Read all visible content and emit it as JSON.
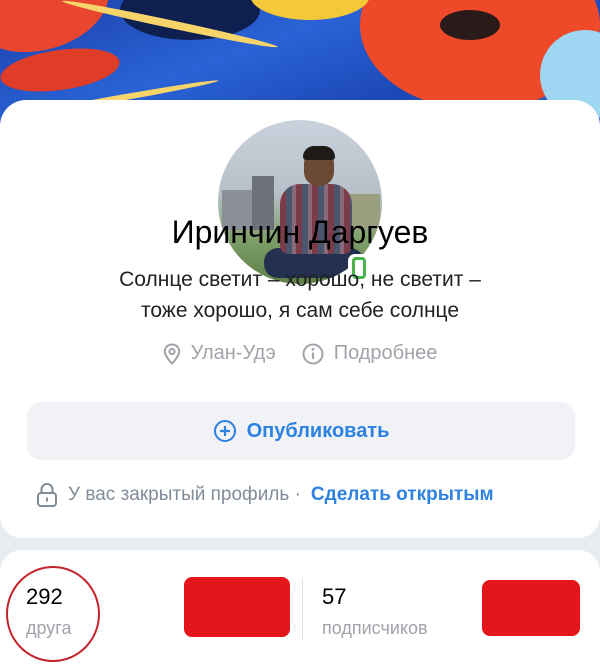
{
  "profile": {
    "name": "Иринчин Даргуев",
    "status": "Солнце светит – хорошо, не светит – тоже хорошо, я сам себе солнце",
    "city": "Улан-Удэ",
    "details_label": "Подробнее"
  },
  "actions": {
    "publish_label": "Опубликовать",
    "closed_text": "У вас закрытый профиль ·",
    "make_open_label": "Сделать открытым"
  },
  "stats": {
    "friends_count": "292",
    "friends_label": "друга",
    "followers_count": "57",
    "followers_label": "подписчиков"
  },
  "colors": {
    "accent": "#2d81e0",
    "online": "#4bb34b",
    "redaction": "#e4161c"
  },
  "icons": {
    "location": "map-pin-icon",
    "details": "info-icon",
    "publish": "plus-circle-icon",
    "closed": "lock-icon",
    "online": "mobile-online-icon"
  }
}
